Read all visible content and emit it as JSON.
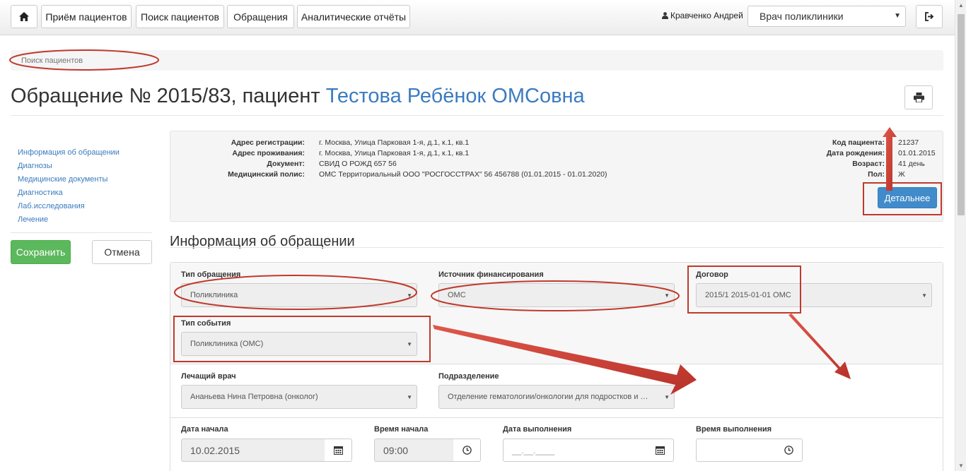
{
  "navbar": {
    "home_icon": "home-icon",
    "items": [
      {
        "label": "Приём пациентов"
      },
      {
        "label": "Поиск пациентов"
      },
      {
        "label": "Обращения"
      },
      {
        "label": "Аналитические отчёты"
      }
    ],
    "user_icon": "user-icon",
    "user_name": "Кравченко Андрей",
    "role": "Врач поликлиники",
    "logout_icon": "logout-icon"
  },
  "breadcrumb": {
    "text": "Поиск пациентов"
  },
  "page": {
    "title_prefix": "Обращение № 2015/83, пациент",
    "patient_name": "Тестова Ребёнок ОМСовна",
    "print_icon": "print-icon"
  },
  "sidebar": {
    "items": [
      {
        "label": "Информация об обращении"
      },
      {
        "label": "Диагнозы"
      },
      {
        "label": "Медицинские документы"
      },
      {
        "label": "Диагностика"
      },
      {
        "label": "Лаб.исследования"
      },
      {
        "label": "Лечение"
      }
    ],
    "save_label": "Сохранить",
    "cancel_label": "Отмена"
  },
  "patient": {
    "left": [
      {
        "key": "Адрес регистрации:",
        "value": "г. Москва, Улица Парковая 1-я, д.1, к.1, кв.1"
      },
      {
        "key": "Адрес проживания:",
        "value": "г. Москва, Улица Парковая 1-я, д.1, к.1, кв.1"
      },
      {
        "key": "Документ:",
        "value": "СВИД О РОЖД 657 56"
      },
      {
        "key": "Медицинский полис:",
        "value": "ОМС Территориальный ООО \"РОСГОССТРАХ\" 56 456788 (01.01.2015 - 01.01.2020)"
      }
    ],
    "right": [
      {
        "key": "Код пациента:",
        "value": "21237"
      },
      {
        "key": "Дата рождения:",
        "value": "01.01.2015"
      },
      {
        "key": "Возраст:",
        "value": "41 день"
      },
      {
        "key": "Пол:",
        "value": "Ж"
      }
    ],
    "details_label": "Детальнее"
  },
  "form": {
    "section_title": "Информация об обращении",
    "visit_type": {
      "label": "Тип обращения",
      "value": "Поликлиника"
    },
    "funding_source": {
      "label": "Источник финансирования",
      "value": "ОМС"
    },
    "contract": {
      "label": "Договор",
      "value": "2015/1 2015-01-01 ОМС"
    },
    "event_type": {
      "label": "Тип события",
      "value": "Поликлиника (ОМС)"
    },
    "doctor": {
      "label": "Лечащий врач",
      "value": "Ананьева Нина Петровна (онколог)"
    },
    "department": {
      "label": "Подразделение",
      "value": "Отделение гематологии/онкологии для подростков и …"
    },
    "start_date": {
      "label": "Дата начала",
      "value": "10.02.2015"
    },
    "start_time": {
      "label": "Время начала",
      "value": "09:00"
    },
    "end_date": {
      "label": "Дата выполнения",
      "placeholder": "__.__.____"
    },
    "end_time": {
      "label": "Время выполнения",
      "value": ""
    },
    "calendar_icon": "calendar-icon",
    "clock_icon": "clock-icon"
  },
  "colors": {
    "link": "#3b7bbf",
    "primary": "#428bca",
    "success": "#5cb85c",
    "annotation": "#c0392b"
  }
}
